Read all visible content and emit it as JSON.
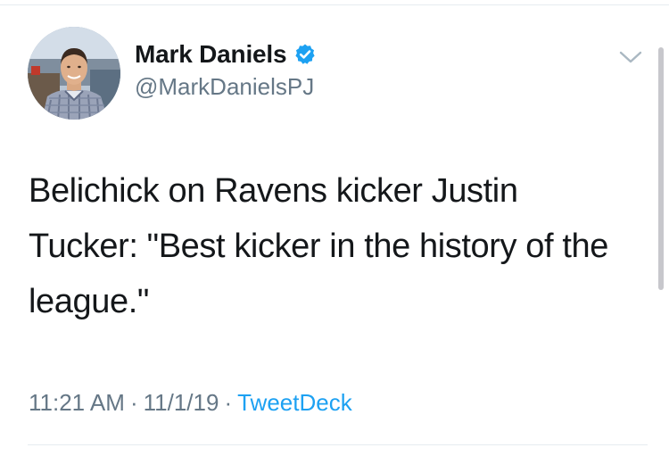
{
  "author": {
    "display_name": "Mark Daniels",
    "handle": "@MarkDanielsPJ",
    "verified": true
  },
  "tweet": {
    "text": "Belichick on Ravens kicker Justin Tucker: \"Best kicker in the history of the league.\"",
    "time": "11:21 AM",
    "date": "11/1/19",
    "separator": "·",
    "source": "TweetDeck"
  },
  "icons": {
    "verified": "verified-badge-icon",
    "more": "chevron-down-icon"
  },
  "colors": {
    "text_primary": "#14171a",
    "text_secondary": "#657786",
    "accent": "#1da1f2",
    "divider": "#e6ecf0"
  }
}
